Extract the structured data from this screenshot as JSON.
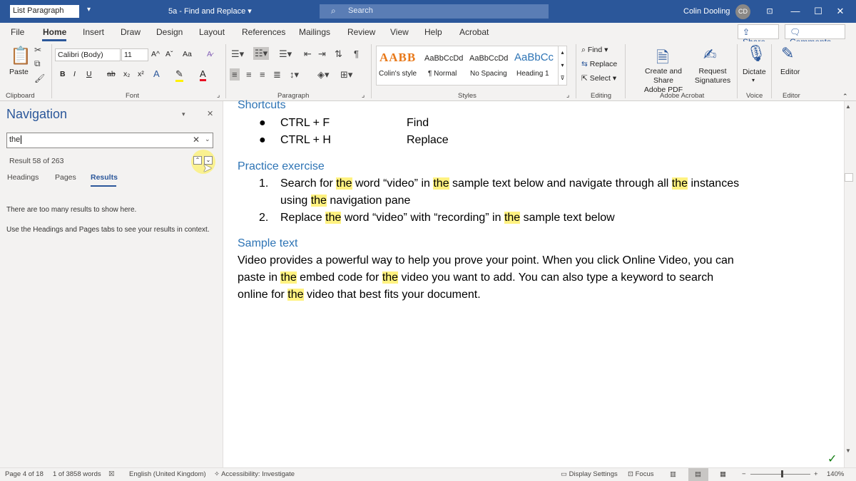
{
  "titlebar": {
    "style_box": "List Paragraph",
    "doc_title": "5a - Find and Replace",
    "search_placeholder": "Search",
    "user_name": "Colin Dooling",
    "avatar_initials": "CD"
  },
  "tabs": [
    "File",
    "Home",
    "Insert",
    "Draw",
    "Design",
    "Layout",
    "References",
    "Mailings",
    "Review",
    "View",
    "Help",
    "Acrobat"
  ],
  "top_buttons": {
    "share": "Share",
    "comments": "Comments"
  },
  "ribbon": {
    "clipboard": {
      "paste": "Paste",
      "label": "Clipboard"
    },
    "font": {
      "name": "Calibri (Body)",
      "size": "11",
      "label": "Font",
      "bold": "B",
      "italic": "I",
      "underline": "U",
      "strike": "ab",
      "subscript": "x₂",
      "superscript": "x²",
      "grow": "A^",
      "shrink": "Aˇ",
      "case": "Aa"
    },
    "paragraph": {
      "label": "Paragraph"
    },
    "styles": {
      "label": "Styles",
      "items": [
        {
          "preview": "AABB",
          "name": "Colin's style"
        },
        {
          "preview": "AaBbCcDd",
          "name": "¶ Normal"
        },
        {
          "preview": "AaBbCcDd",
          "name": "No Spacing"
        },
        {
          "preview": "AaBbCc",
          "name": "Heading 1"
        }
      ]
    },
    "editing": {
      "find": "Find",
      "replace": "Replace",
      "select": "Select",
      "label": "Editing"
    },
    "acrobat": {
      "create_share": "Create and Share",
      "adobe_pdf": "Adobe PDF",
      "request": "Request",
      "signatures": "Signatures",
      "label": "Adobe Acrobat"
    },
    "voice": {
      "dictate": "Dictate",
      "label": "Voice"
    },
    "editor": {
      "editor": "Editor",
      "label": "Editor"
    }
  },
  "navigation": {
    "title": "Navigation",
    "search_value": "the",
    "result_count": "Result 58 of 263",
    "tabs": [
      "Headings",
      "Pages",
      "Results"
    ],
    "message1": "There are too many results to show here.",
    "message2": "Use the Headings and Pages tabs to see your results in context."
  },
  "document": {
    "shortcuts_heading": "Shortcuts",
    "shortcuts": [
      {
        "keys": "CTRL + F",
        "action": "Find"
      },
      {
        "keys": "CTRL + H",
        "action": "Replace"
      }
    ],
    "practice_heading": "Practice exercise",
    "practice_items": [
      {
        "num": "1.",
        "line1_a": "Search for ",
        "hl": "the",
        "line1_b": " word “video” in ",
        "line1_c": " sample text below and navigate through all ",
        "line1_d": " instances",
        "line2_a": "using ",
        "line2_b": " navigation pane"
      },
      {
        "num": "2.",
        "a": "Replace ",
        "b": " word “video” with “recording” in ",
        "c": " sample text below"
      }
    ],
    "sample_heading": "Sample text",
    "sample_lines": [
      {
        "a": "Video provides a powerful way to help you prove your point. When you click Online Video, you can"
      },
      {
        "a": "paste in ",
        "b": " embed code for ",
        "c": " video you want to add. You can also type a keyword to search"
      },
      {
        "a": "online for ",
        "b": " video that best fits your document."
      }
    ],
    "highlight_word": "the"
  },
  "statusbar": {
    "page": "Page 4 of 18",
    "words": "1 of 3858 words",
    "language": "English (United Kingdom)",
    "accessibility": "Accessibility: Investigate",
    "display_settings": "Display Settings",
    "focus": "Focus",
    "zoom": "140%"
  },
  "colors": {
    "brand": "#2b579a",
    "highlight": "#fff280",
    "heading": "#2e74b5"
  }
}
